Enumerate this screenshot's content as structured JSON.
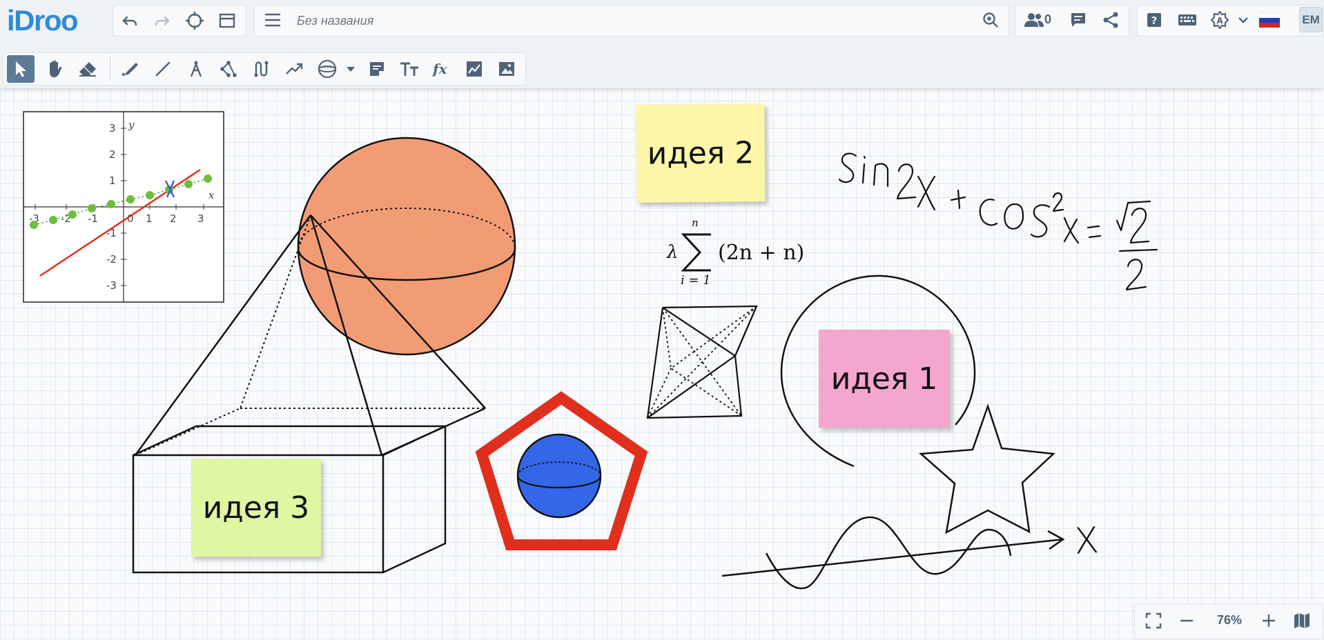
{
  "app": {
    "logo": "iDroo"
  },
  "document": {
    "title_value": "",
    "title_placeholder": "Без названия"
  },
  "header": {
    "users_count": "0",
    "language": "ru",
    "user_initials": "EM"
  },
  "toolbar_top": [
    "undo",
    "redo",
    "focus",
    "window-layout",
    "menu",
    "zoom-in",
    "users",
    "chat",
    "share",
    "help",
    "keyboard",
    "settings",
    "language-flag"
  ],
  "toolbar_tools": [
    "select",
    "hand",
    "eraser",
    "pen",
    "line",
    "compass",
    "polyline",
    "curve",
    "arrow-line",
    "shape-sphere",
    "dropdown",
    "sticky-note",
    "text",
    "formula",
    "graph",
    "image"
  ],
  "stickies": [
    {
      "id": "note-2",
      "text": "идея 2",
      "color": "#fbf6a8"
    },
    {
      "id": "note-1",
      "text": "идея 1",
      "color": "#f4a6cf"
    },
    {
      "id": "note-3",
      "text": "идея 3",
      "color": "#dff6a2"
    }
  ],
  "formula": {
    "lambda": "λ",
    "sum_upper": "n",
    "sum_lower": "i = 1",
    "body": "(2n + n)"
  },
  "handwriting": {
    "trig": "sin 2x + cos²x = √2/2",
    "axis_label": "X"
  },
  "graph_widget": {
    "x_label": "x",
    "y_label": "y",
    "x_ticks": [
      "-3",
      "-2",
      "-1",
      "0",
      "1",
      "2",
      "3"
    ],
    "y_ticks": [
      "3",
      "2",
      "1",
      "-1",
      "-2",
      "-3"
    ]
  },
  "zoom": {
    "level": "76%"
  },
  "colors": {
    "accent": "#2f8bd9",
    "sphere_orange": "#f29c76",
    "sphere_blue": "#3466e8",
    "pentagon_red": "#e02f1d",
    "graph_line_red": "#e0301e",
    "graph_dots_green": "#6bbf3a"
  }
}
